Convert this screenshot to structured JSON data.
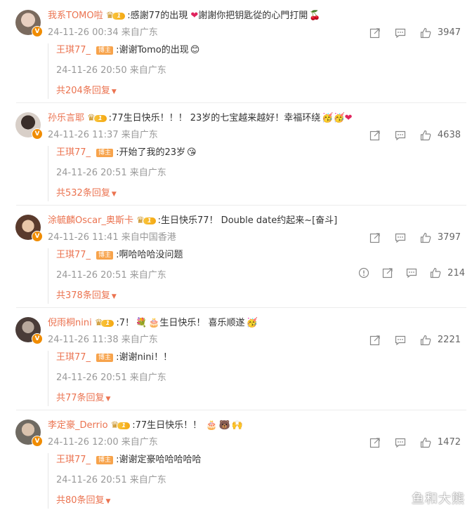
{
  "comments": [
    {
      "user": "我系TOMO啦",
      "text": ":感謝77的出現",
      "text2": " 謝謝你把钥匙從的心門打開",
      "time": "24-11-26 00:34",
      "location": "来自广东",
      "likes": "3947",
      "avatar_color": "#7a6a5e",
      "reply": {
        "user": "王琪77_",
        "badge": "博主",
        "text": ":谢谢Tomo的出现",
        "time": "24-11-26 20:50",
        "location": "来自广东",
        "more": "共204条回复"
      }
    },
    {
      "user": "孙乐言耶",
      "text": ":77生日快乐！！！ 23岁的七宝越来越好！幸福环绕",
      "text2": "",
      "time": "24-11-26 11:37",
      "location": "来自广东",
      "likes": "4638",
      "avatar_color": "#c9b8b0",
      "reply": {
        "user": "王琪77_",
        "badge": "博主",
        "text": ":开始了我的23岁",
        "time": "24-11-26 20:51",
        "location": "来自广东",
        "more": "共532条回复"
      }
    },
    {
      "user": "涂毓麟Oscar_奥斯卡",
      "text": ":生日快乐77！ Double date约起来~[奋斗]",
      "text2": "",
      "time": "24-11-26 11:41",
      "location": "来自中国香港",
      "likes": "3797",
      "avatar_color": "#8a5a44",
      "reply": {
        "user": "王琪77_",
        "badge": "博主",
        "text": ":啊哈哈哈没问题",
        "time": "24-11-26 20:51",
        "location": "来自广东",
        "more": "共378条回复",
        "likes": "214"
      }
    },
    {
      "user": "倪雨桐nini",
      "text": ":7！",
      "text2": " 生日快乐！ 喜乐顺遂",
      "time": "24-11-26 11:38",
      "location": "来自广东",
      "likes": "2221",
      "avatar_color": "#5a4a48",
      "reply": {
        "user": "王琪77_",
        "badge": "博主",
        "text": ":谢谢nini！！",
        "time": "24-11-26 20:51",
        "location": "来自广东",
        "more": "共77条回复"
      }
    },
    {
      "user": "李定豪_Derrio",
      "text": ":77生日快乐！！",
      "text2": "",
      "time": "24-11-26 12:00",
      "location": "来自广东",
      "likes": "1472",
      "avatar_color": "#6f6a62",
      "reply": {
        "user": "王琪77_",
        "badge": "博主",
        "text": ":谢谢定豪哈哈哈哈哈",
        "time": "24-11-26 20:51",
        "location": "来自广东",
        "more": "共80条回复"
      }
    }
  ],
  "level_badge": "1",
  "watermark": "鱼和大熊",
  "colors": {
    "username": "#eb7350",
    "meta": "#999999",
    "badge": "#f7a34b"
  }
}
